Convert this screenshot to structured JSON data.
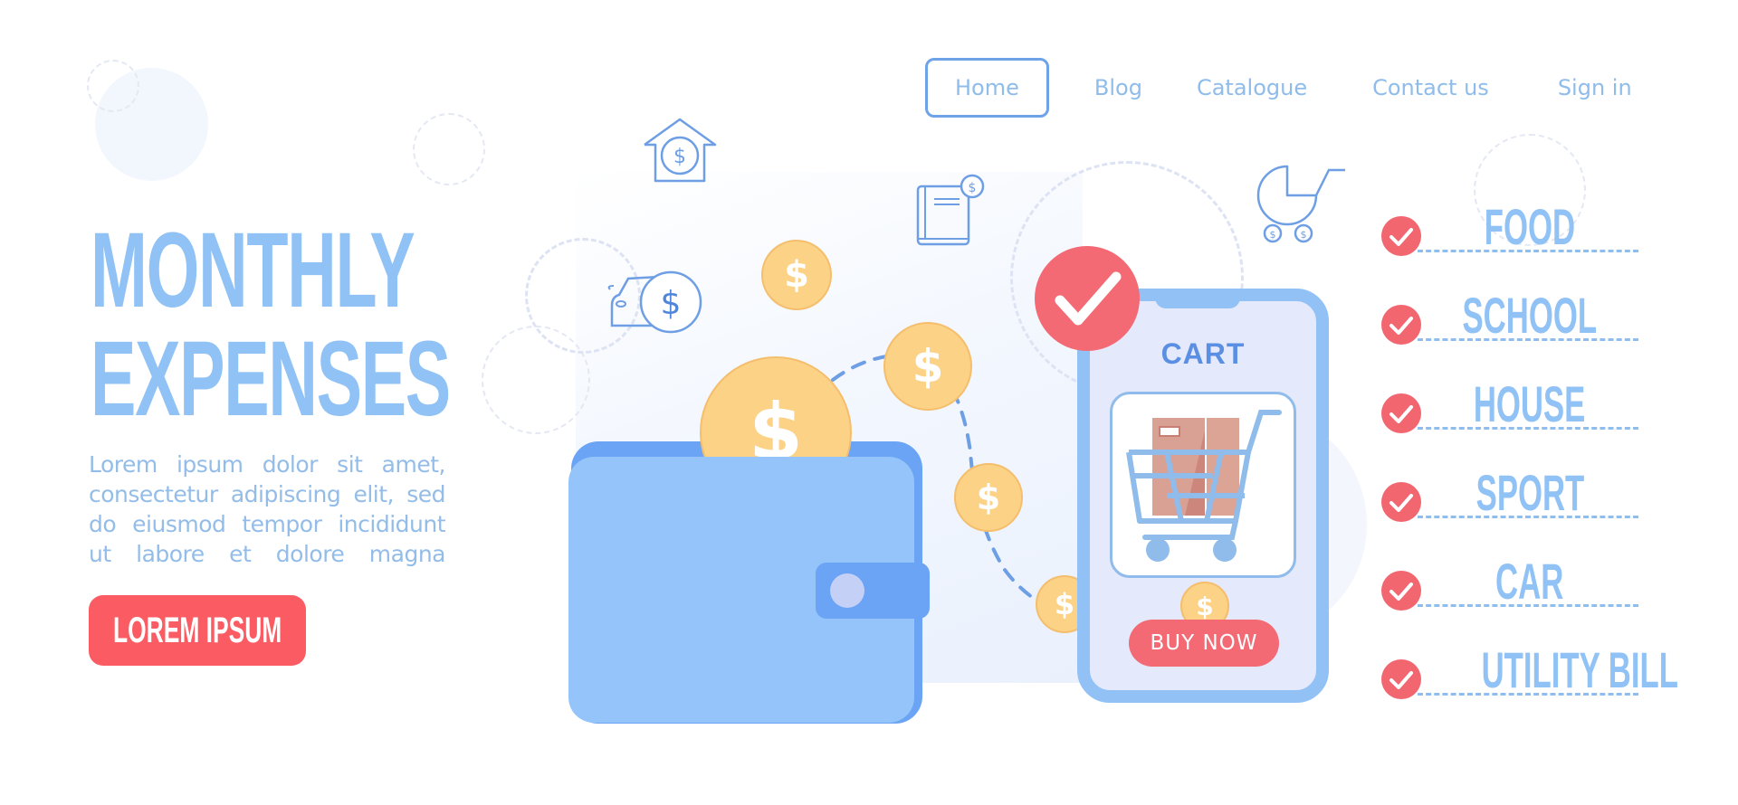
{
  "nav": {
    "items": [
      {
        "label": "Home",
        "active": true
      },
      {
        "label": "Blog",
        "active": false
      },
      {
        "label": "Catalogue",
        "active": false
      },
      {
        "label": "Contact us",
        "active": false
      },
      {
        "label": "Sign in",
        "active": false
      }
    ]
  },
  "hero": {
    "title_line1": "MONTHLY",
    "title_line2": "EXPENSES",
    "body_lines": [
      "Lorem ipsum dolor sit amet,",
      "consectetur adipiscing elit, sed",
      "do eiusmod tempor incididunt",
      "ut labore et dolore magna"
    ],
    "cta_label": "LOREM IPSUM"
  },
  "illustration": {
    "phone": {
      "title": "CART",
      "buy_label": "BUY NOW"
    },
    "coin_symbol": "$",
    "icons": [
      "house-dollar-icon",
      "car-dollar-icon",
      "book-dollar-icon",
      "stroller-dollar-icon",
      "wallet-icon",
      "shopping-cart-icon",
      "checkmark-icon"
    ]
  },
  "checklist": {
    "items": [
      {
        "label": "FOOD",
        "checked": true
      },
      {
        "label": "SCHOOL",
        "checked": true
      },
      {
        "label": "HOUSE",
        "checked": true
      },
      {
        "label": "SPORT",
        "checked": true
      },
      {
        "label": "CAR",
        "checked": true
      },
      {
        "label": "UTILITY BILL",
        "checked": true
      }
    ]
  },
  "colors": {
    "primary_blue": "#90c2f5",
    "nav_border": "#6ea3e8",
    "accent_red": "#fb5b62",
    "coin_gold": "#fcd287",
    "wallet_blue": "#94c4fa"
  }
}
